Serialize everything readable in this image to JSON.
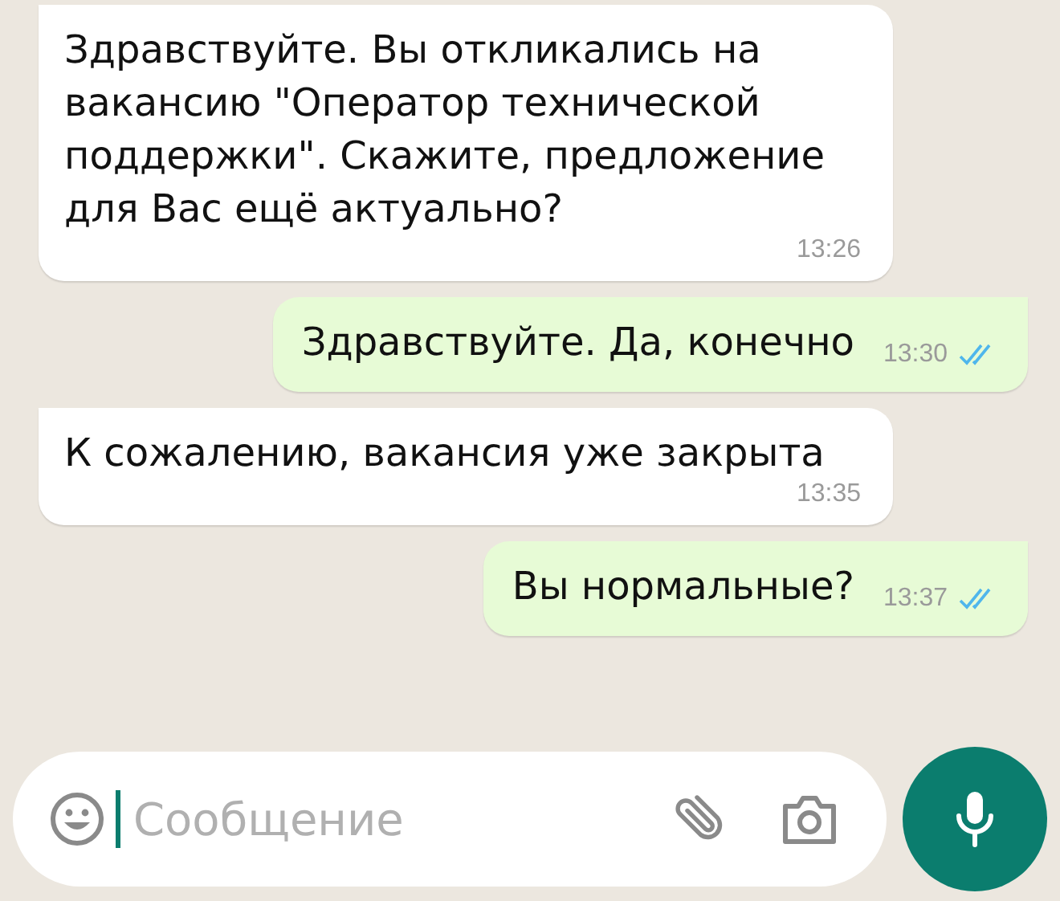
{
  "messages": [
    {
      "kind": "incoming",
      "text": "Здравствуйте. Вы откликались на вакансию \"Оператор технической поддержки\". Скажите, предложение для Вас ещё актуально?",
      "time": "13:26"
    },
    {
      "kind": "outgoing",
      "text": "Здравствуйте. Да, конечно",
      "time": "13:30",
      "read": true
    },
    {
      "kind": "incoming",
      "text": "К сожалению, вакансия уже закрыта",
      "time": "13:35"
    },
    {
      "kind": "outgoing",
      "text": "Вы нормальные?",
      "time": "13:37",
      "read": true
    }
  ],
  "composer": {
    "placeholder": "Сообщение"
  }
}
